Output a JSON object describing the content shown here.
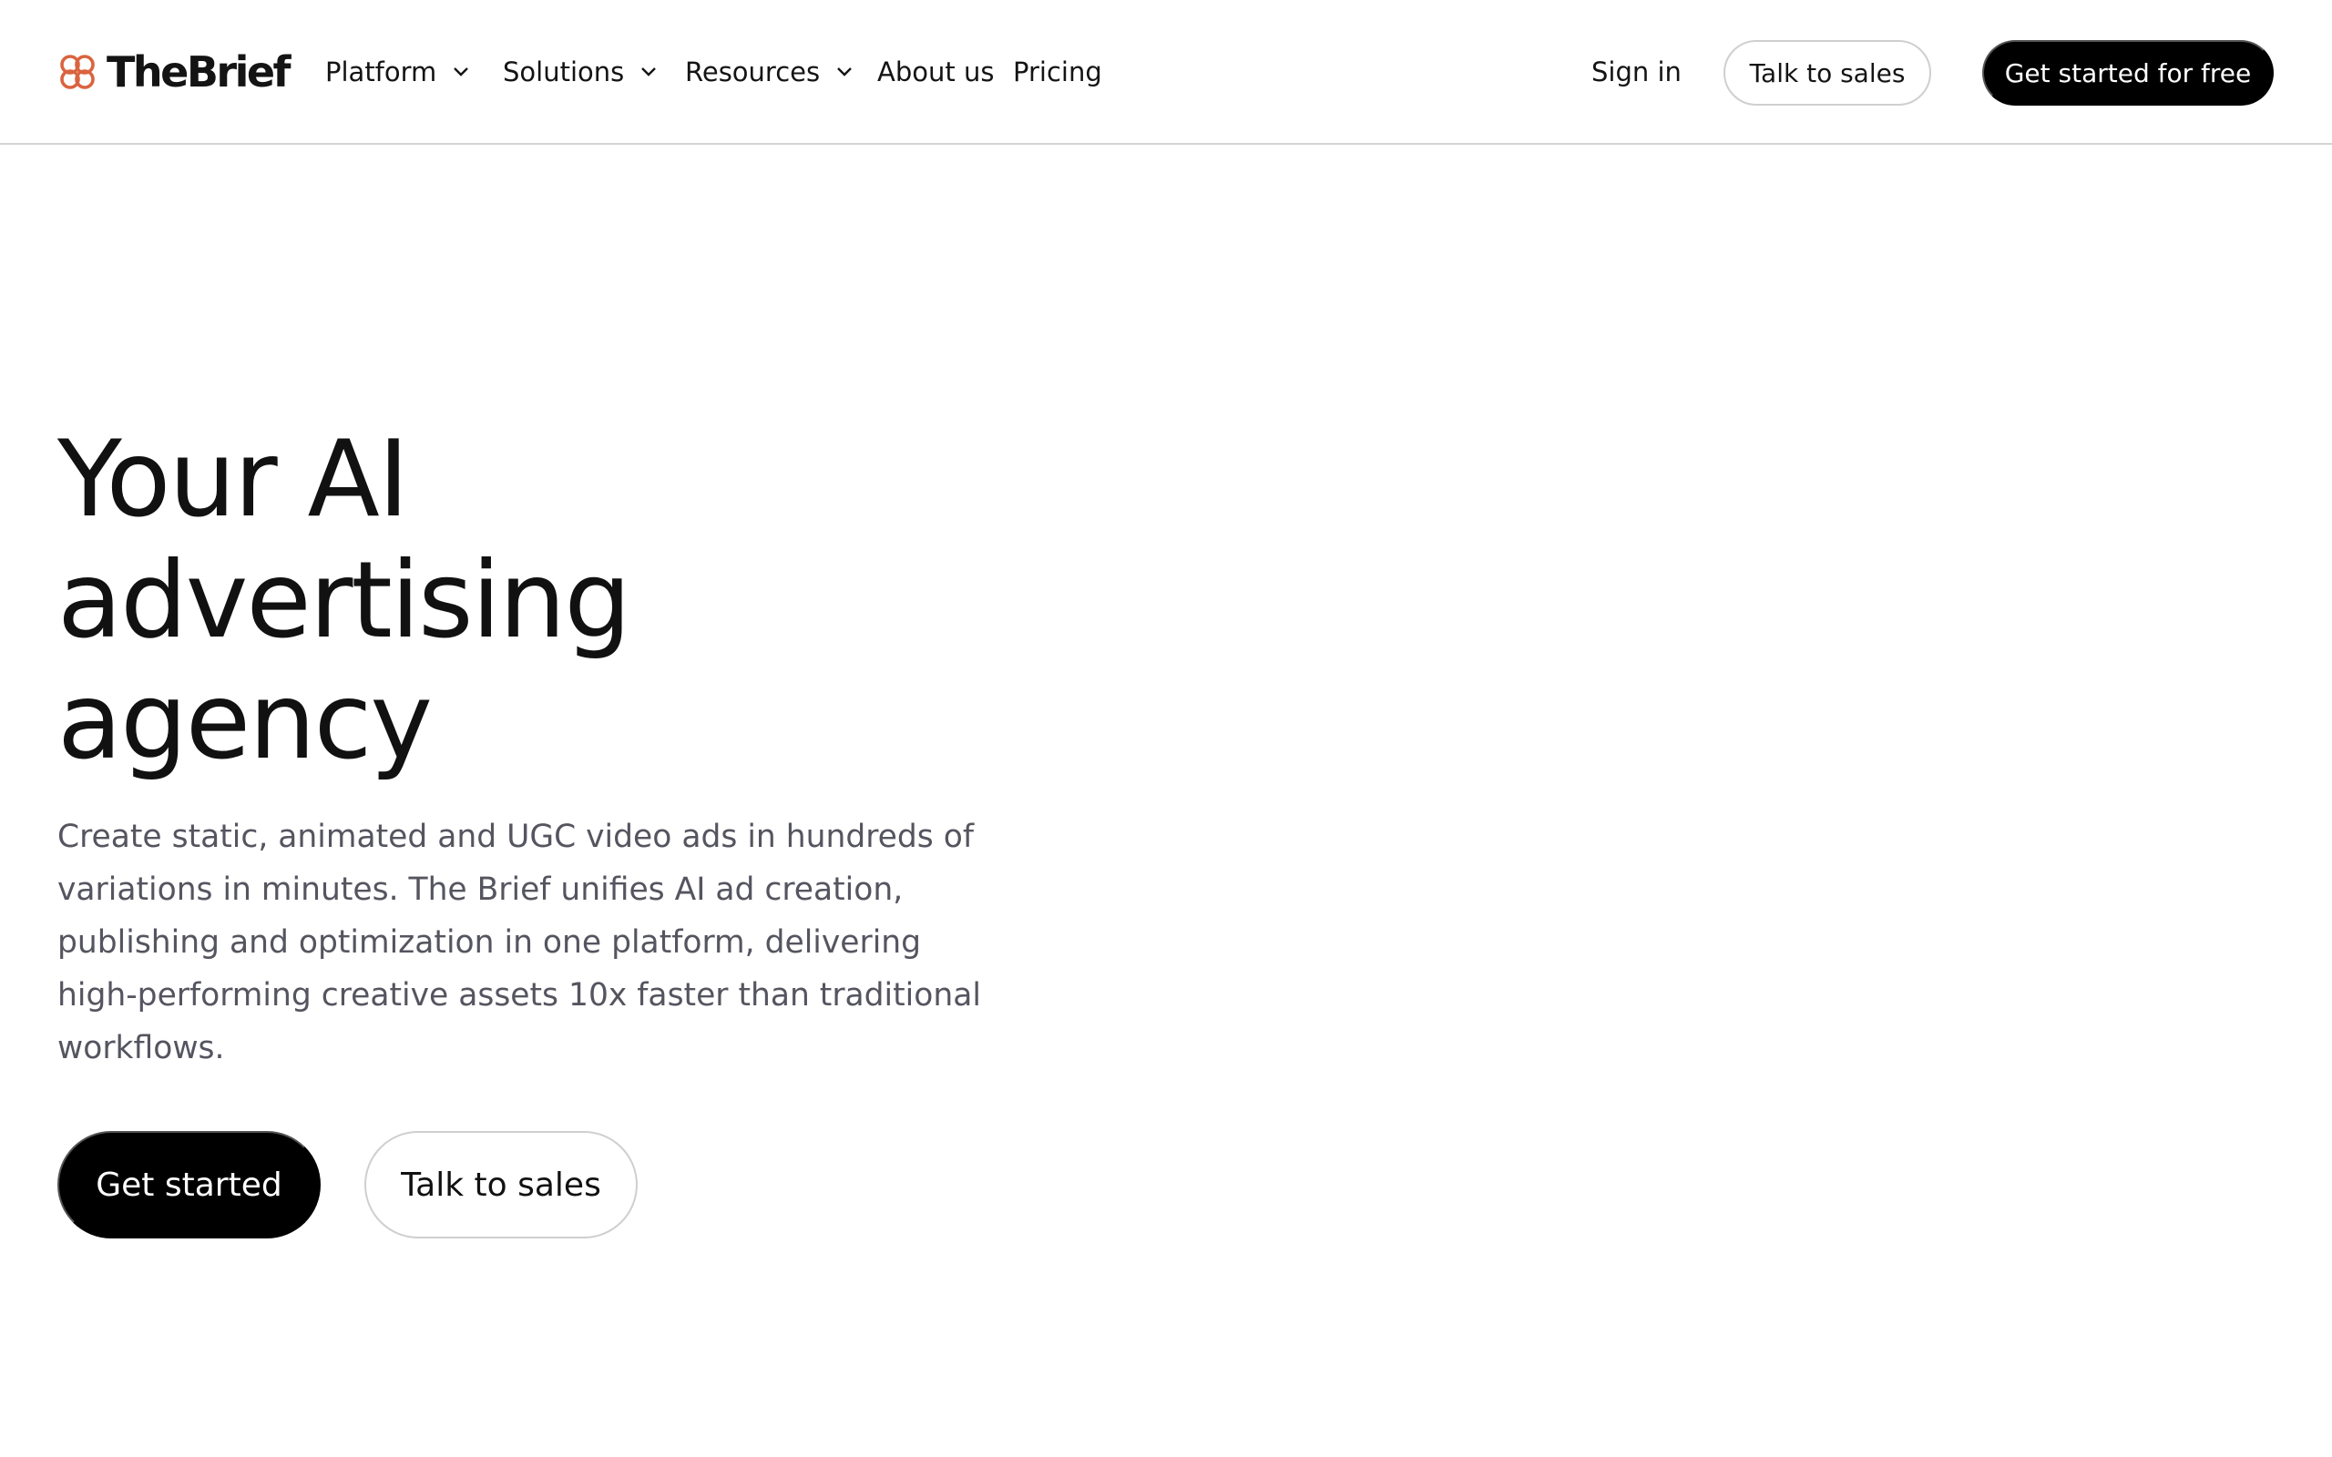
{
  "header": {
    "logo_text": "TheBrief",
    "logo_icon": "thebrief-knot-logo-icon",
    "nav": [
      {
        "label": "Platform",
        "has_dropdown": true
      },
      {
        "label": "Solutions",
        "has_dropdown": true
      },
      {
        "label": "Resources",
        "has_dropdown": true
      },
      {
        "label": "About us",
        "has_dropdown": false
      },
      {
        "label": "Pricing",
        "has_dropdown": false
      }
    ],
    "sign_in": "Sign in",
    "talk_to_sales": "Talk to sales",
    "get_started_free": "Get started for free"
  },
  "hero": {
    "title_lines": [
      "Your AI",
      "advertising",
      "agency"
    ],
    "description_lines": [
      "Create static, animated and UGC video ads in hundreds of",
      "variations in minutes. The Brief unifies AI ad creation,",
      "publishing and optimization in one platform, delivering",
      "high-performing creative assets 10x faster than traditional",
      "workflows."
    ],
    "primary_cta": "Get started",
    "secondary_cta": "Talk to sales"
  },
  "colors": {
    "accent_logo": "#d9643f",
    "primary_button": "#000000",
    "text": "#111111",
    "muted_text": "#555560",
    "border": "#cfcfcf"
  }
}
